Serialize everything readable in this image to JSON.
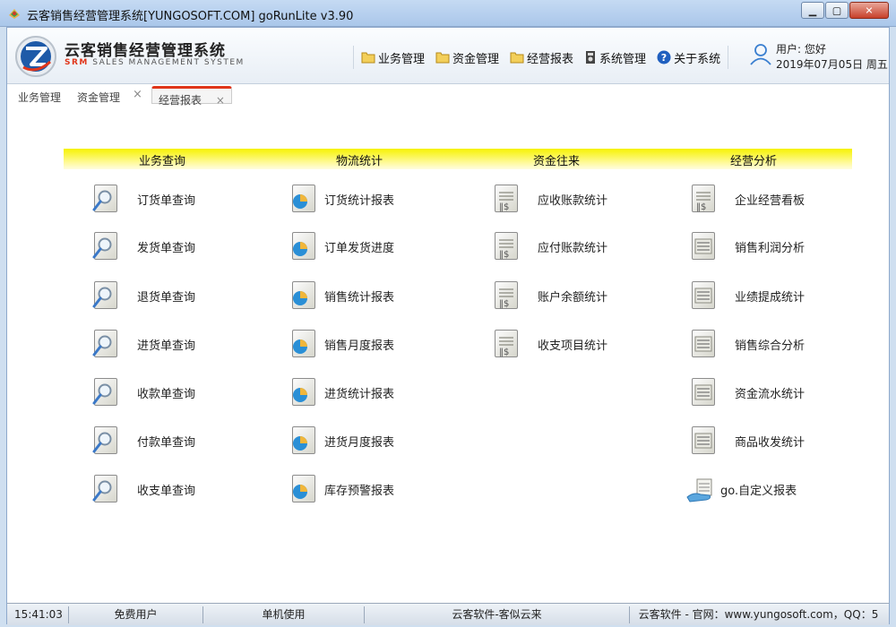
{
  "window": {
    "title": "云客销售经营管理系统[YUNGOSOFT.COM]  goRunLite v3.90",
    "buttons": [
      "minimize",
      "maximize",
      "close"
    ]
  },
  "brand": {
    "name": "云客销售经营管理系统",
    "subtitle_srm": "SRM",
    "subtitle_rest": " SALES MANAGEMENT SYSTEM",
    "accent": "#e0361b"
  },
  "menu": [
    {
      "label": "业务管理",
      "icon": "folder-icon"
    },
    {
      "label": "资金管理",
      "icon": "folder-icon"
    },
    {
      "label": "经营报表",
      "icon": "folder-icon"
    },
    {
      "label": "系统管理",
      "icon": "settings-icon"
    },
    {
      "label": "关于系统",
      "icon": "help-icon"
    }
  ],
  "user": {
    "greeting": "用户: 您好",
    "date": "2019年07月05日 周五"
  },
  "tabs": {
    "t1": "业务管理",
    "t2": "资金管理",
    "t3": "经营报表",
    "close_glyph": "×",
    "active": "经营报表"
  },
  "categories": [
    "业务查询",
    "物流统计",
    "资金往来",
    "经营分析"
  ],
  "columns": {
    "c1": [
      {
        "label": "订货单查询",
        "icon": "document-search-icon"
      },
      {
        "label": "发货单查询",
        "icon": "document-search-icon"
      },
      {
        "label": "退货单查询",
        "icon": "document-search-icon"
      },
      {
        "label": "进货单查询",
        "icon": "document-search-icon"
      },
      {
        "label": "收款单查询",
        "icon": "document-search-icon"
      },
      {
        "label": "付款单查询",
        "icon": "document-search-icon"
      },
      {
        "label": "收支单查询",
        "icon": "document-search-icon"
      }
    ],
    "c2": [
      {
        "label": "订货统计报表",
        "icon": "pie-report-icon"
      },
      {
        "label": "订单发货进度",
        "icon": "pie-report-icon"
      },
      {
        "label": "销售统计报表",
        "icon": "pie-report-icon"
      },
      {
        "label": "销售月度报表",
        "icon": "pie-report-icon"
      },
      {
        "label": "进货统计报表",
        "icon": "pie-report-icon"
      },
      {
        "label": "进货月度报表",
        "icon": "pie-report-icon"
      },
      {
        "label": "库存预警报表",
        "icon": "pie-report-icon"
      }
    ],
    "c3": [
      {
        "label": "应收账款统计",
        "icon": "ledger-dollar-icon"
      },
      {
        "label": "应付账款统计",
        "icon": "ledger-dollar-icon"
      },
      {
        "label": "账户余额统计",
        "icon": "ledger-dollar-icon"
      },
      {
        "label": "收支项目统计",
        "icon": "ledger-dollar-icon"
      }
    ],
    "c4": [
      {
        "label": "企业经营看板",
        "icon": "ledger-icon"
      },
      {
        "label": "销售利润分析",
        "icon": "list-report-icon"
      },
      {
        "label": "业绩提成统计",
        "icon": "list-report-icon"
      },
      {
        "label": "销售综合分析",
        "icon": "list-report-icon"
      },
      {
        "label": "资金流水统计",
        "icon": "list-report-icon"
      },
      {
        "label": "商品收发统计",
        "icon": "list-report-icon"
      },
      {
        "label": "go.自定义报表",
        "icon": "hand-report-icon"
      }
    ]
  },
  "status": {
    "time": "15:41:03",
    "user": "免费用户",
    "mode": "单机使用",
    "slogan": "云客软件-客似云来",
    "info": "云客软件 - 官网：www.yungosoft.com，QQ：5"
  }
}
